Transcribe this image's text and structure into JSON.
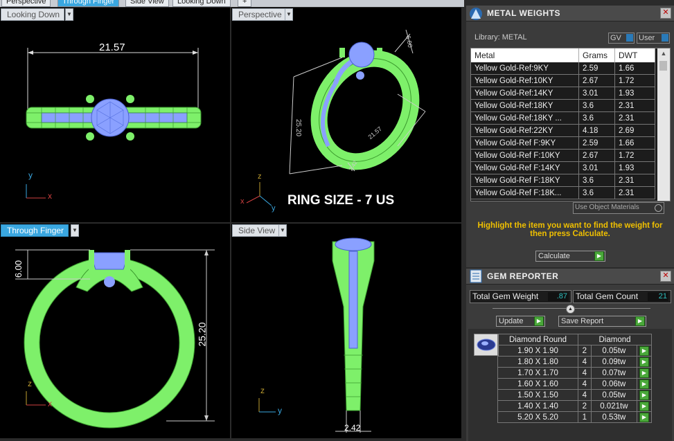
{
  "tabs": [
    "Perspective",
    "Through Finger",
    "Side View",
    "Looking Down",
    "+"
  ],
  "viewports": {
    "looking_down": {
      "label": "Looking Down",
      "dimension": "21.57",
      "axis_v": "y",
      "axis_h": "x"
    },
    "perspective": {
      "label": "Perspective",
      "dim_height": "25.20",
      "dim_top": "6.00",
      "dim_side": "21.57",
      "dim_small": "2.42",
      "caption": "RING SIZE - 7 US",
      "axis_z": "z",
      "axis_x": "x",
      "axis_y": "y"
    },
    "through_finger": {
      "label": "Through Finger",
      "dim_top": "6.00",
      "dim_height": "25.20",
      "axis_z": "z",
      "axis_x": "x"
    },
    "side_view": {
      "label": "Side View",
      "dim_width": "2.42",
      "axis_z": "z",
      "axis_y": "y"
    }
  },
  "metal_weights": {
    "title": "METAL WEIGHTS",
    "library_label": "Library: METAL",
    "gv_label": "GV",
    "user_label": "User",
    "columns": [
      "Metal",
      "Grams",
      "DWT"
    ],
    "rows": [
      {
        "metal": "Yellow Gold-Ref:9KY",
        "grams": "2.59",
        "dwt": "1.66"
      },
      {
        "metal": "Yellow Gold-Ref:10KY",
        "grams": "2.67",
        "dwt": "1.72"
      },
      {
        "metal": "Yellow Gold-Ref:14KY",
        "grams": "3.01",
        "dwt": "1.93"
      },
      {
        "metal": "Yellow Gold-Ref:18KY",
        "grams": "3.6",
        "dwt": "2.31"
      },
      {
        "metal": "Yellow Gold-Ref:18KY ...",
        "grams": "3.6",
        "dwt": "2.31"
      },
      {
        "metal": "Yellow Gold-Ref:22KY",
        "grams": "4.18",
        "dwt": "2.69"
      },
      {
        "metal": "Yellow Gold-Ref F:9KY",
        "grams": "2.59",
        "dwt": "1.66"
      },
      {
        "metal": "Yellow Gold-Ref F:10KY",
        "grams": "2.67",
        "dwt": "1.72"
      },
      {
        "metal": "Yellow Gold-Ref F:14KY",
        "grams": "3.01",
        "dwt": "1.93"
      },
      {
        "metal": "Yellow Gold-Ref F:18KY",
        "grams": "3.6",
        "dwt": "2.31"
      },
      {
        "metal": "Yellow Gold-Ref F:18K...",
        "grams": "3.6",
        "dwt": "2.31"
      }
    ],
    "use_object_materials": "Use Object Materials",
    "hint": "Highlight the item you want to find the weight for then press Calculate.",
    "calculate_label": "Calculate"
  },
  "gem_reporter": {
    "title": "GEM REPORTER",
    "total_weight_label": "Total Gem Weight",
    "total_weight_value": ".87",
    "total_count_label": "Total Gem Count",
    "total_count_value": "21",
    "update_label": "Update",
    "save_report_label": "Save Report",
    "shape_header": "Diamond Round",
    "type_header": "Diamond",
    "rows": [
      {
        "size": "1.90 X 1.90",
        "count": "2",
        "weight": "0.05tw"
      },
      {
        "size": "1.80 X 1.80",
        "count": "4",
        "weight": "0.09tw"
      },
      {
        "size": "1.70 X 1.70",
        "count": "4",
        "weight": "0.07tw"
      },
      {
        "size": "1.60 X 1.60",
        "count": "4",
        "weight": "0.06tw"
      },
      {
        "size": "1.50 X 1.50",
        "count": "4",
        "weight": "0.05tw"
      },
      {
        "size": "1.40 X 1.40",
        "count": "2",
        "weight": "0.021tw"
      },
      {
        "size": "5.20 X 5.20",
        "count": "1",
        "weight": "0.53tw"
      }
    ]
  },
  "colors": {
    "metal": "#7ef06a",
    "gem": "#8aa0ff",
    "accent": "#3aa7e0",
    "hint": "#f0c000"
  }
}
